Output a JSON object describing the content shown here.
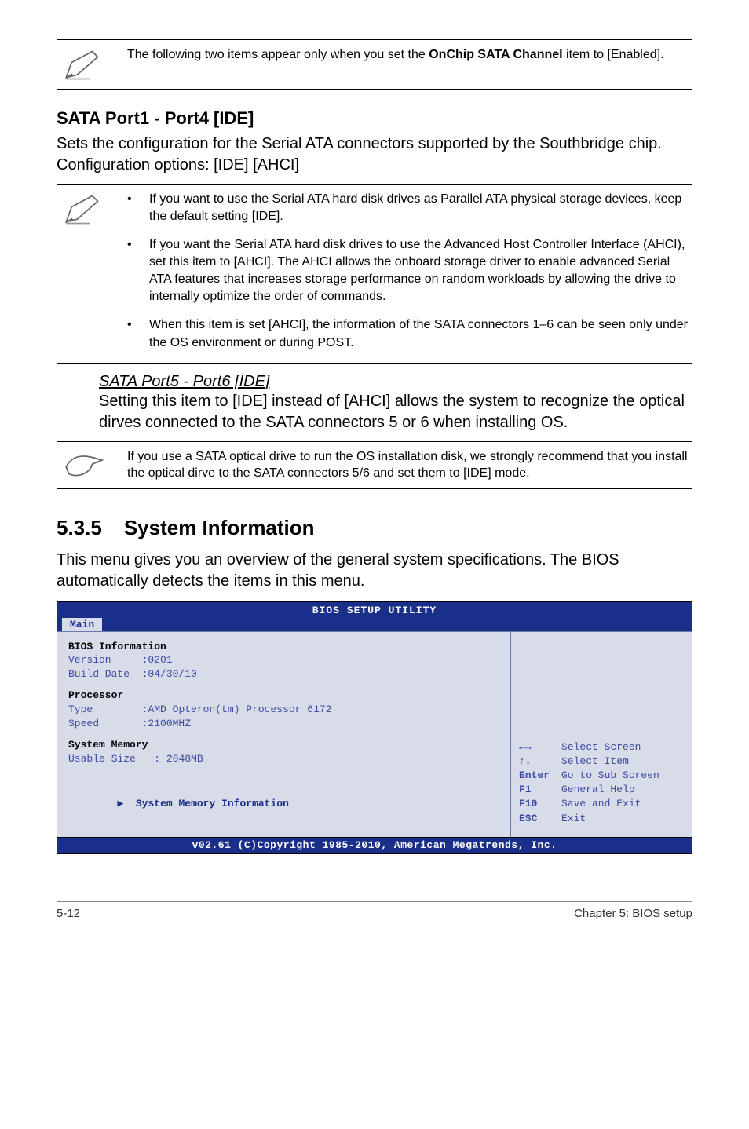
{
  "note1": "The following two items appear only when you set the OnChip SATA Channel item to [Enabled].",
  "note1_prefix": "The following two items appear only when you set the ",
  "note1_bold": "OnChip SATA Channel",
  "note1_suffix": " item to [Enabled].",
  "h_sata14": "SATA Port1 - Port4 [IDE]",
  "p_sata14": "Sets the configuration for the Serial ATA connectors supported by the Southbridge chip. Configuration options: [IDE] [AHCI]",
  "bul1": "If you want to use the Serial ATA hard disk drives as Parallel ATA physical storage devices, keep the default setting [IDE].",
  "bul2": "If you want the Serial ATA hard disk drives to use the Advanced Host Controller Interface (AHCI), set this item to [AHCI]. The AHCI allows the onboard storage driver to enable advanced Serial ATA features that increases storage performance on random workloads by allowing the drive to internally optimize the order of commands.",
  "bul3": "When this item is set [AHCI], the information of the SATA connectors 1–6 can be seen only under the OS environment or during POST.",
  "sub_h": "SATA Port5 - Port6 [IDE]",
  "sub_p": "Setting this item to [IDE] instead of [AHCI] allows the system to recognize the optical dirves connected to the SATA connectors 5 or 6 when installing OS.",
  "note2": "If you use a SATA optical drive to run the OS installation disk, we strongly recommend that you install the optical dirve to the SATA connectors 5/6 and set them to [IDE] mode.",
  "h2_num": "5.3.5",
  "h2_txt": "System Information",
  "p_sysinfo": "This menu gives you an overview of the general system specifications. The BIOS automatically detects the items in this menu.",
  "bios": {
    "title": "BIOS SETUP UTILITY",
    "tab": "Main",
    "left": {
      "bios_info": "BIOS Information",
      "version_lbl": "Version",
      "version_val": ":0201",
      "build_lbl": "Build Date",
      "build_val": ":04/30/10",
      "proc": "Processor",
      "type_lbl": "Type",
      "type_val": ":AMD Opteron(tm) Processor 6172",
      "speed_lbl": "Speed",
      "speed_val": ":2100MHZ",
      "sysmem": "System Memory",
      "usable_lbl": "Usable Size",
      "usable_val": ": 2048MB",
      "link": "System Memory Information",
      "chart_data": {
        "type": "table",
        "rows": [
          {
            "label": "Version",
            "value": "0201"
          },
          {
            "label": "Build Date",
            "value": "04/30/10"
          },
          {
            "label": "Processor Type",
            "value": "AMD Opteron(tm) Processor 6172"
          },
          {
            "label": "Processor Speed",
            "value": "2100MHZ"
          },
          {
            "label": "System Memory Usable Size",
            "value": "2048MB"
          }
        ]
      }
    },
    "help": [
      {
        "key": "←→",
        "txt": "Select Screen"
      },
      {
        "key": "↑↓",
        "txt": "Select Item"
      },
      {
        "key": "Enter",
        "txt": "Go to Sub Screen"
      },
      {
        "key": "F1",
        "txt": "General Help"
      },
      {
        "key": "F10",
        "txt": "Save and Exit"
      },
      {
        "key": "ESC",
        "txt": "Exit"
      }
    ],
    "foot": "v02.61 (C)Copyright 1985-2010, American Megatrends, Inc."
  },
  "footer_left": "5-12",
  "footer_right": "Chapter 5: BIOS setup"
}
